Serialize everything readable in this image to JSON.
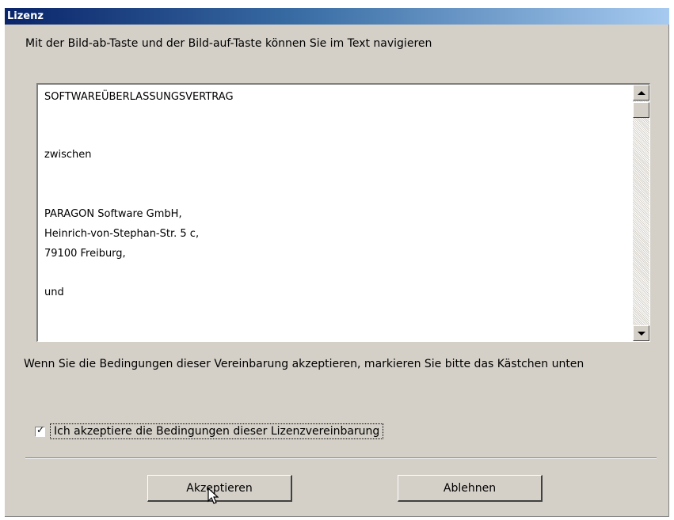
{
  "window": {
    "title": "Lizenz"
  },
  "instruction": "Mit der Bild-ab-Taste und der Bild-auf-Taste können Sie im Text navigieren",
  "license_text": {
    "lines": [
      "SOFTWAREÜBERLASSUNGSVERTRAG",
      "zwischen",
      "PARAGON Software GmbH,",
      "Heinrich-von-Stephan-Str. 5 c,",
      "79100 Freiburg,",
      "und"
    ]
  },
  "condition_text": "Wenn Sie die Bedingungen dieser Vereinbarung akzeptieren, markieren Sie bitte das Kästchen unten",
  "checkbox": {
    "label": "Ich akzeptiere die Bedingungen dieser Lizenzvereinbarung",
    "checked": true
  },
  "buttons": {
    "accept": "Akzeptieren",
    "decline": "Ablehnen"
  },
  "colors": {
    "titlebar_start": "#0a246a",
    "titlebar_end": "#a6caf0",
    "dialog_bg": "#d4d0c8"
  }
}
